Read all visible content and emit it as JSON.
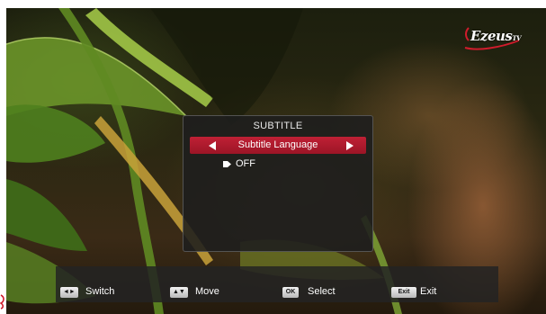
{
  "brand": {
    "logo_text": "Ezeus",
    "logo_suffix": "TV"
  },
  "dialog": {
    "title": "SUBTITLE",
    "language_label": "Subtitle Language",
    "options": [
      {
        "label": "OFF",
        "selected": true
      }
    ],
    "accent_color": "#b01b2e"
  },
  "footer": {
    "hints": [
      {
        "key": "◄►",
        "label": "Switch"
      },
      {
        "key": "▲▼",
        "label": "Move"
      },
      {
        "key": "OK",
        "label": "Select"
      },
      {
        "key": "Exit",
        "label": "Exit"
      }
    ]
  }
}
